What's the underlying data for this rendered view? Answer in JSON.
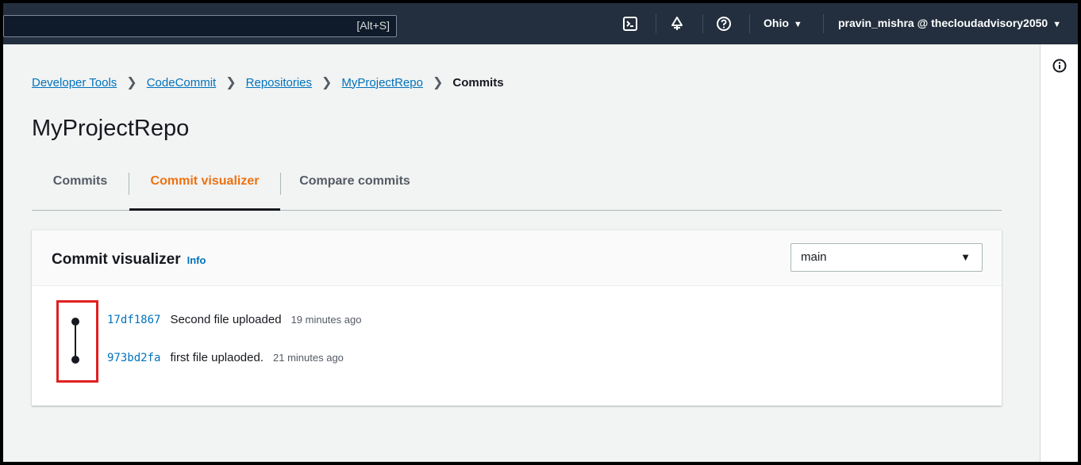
{
  "topbar": {
    "search_shortcut": "[Alt+S]",
    "region": "Ohio",
    "account": "pravin_mishra @ thecloudadvisory2050",
    "icons": [
      "cloudshell-icon",
      "bell-icon",
      "help-icon"
    ]
  },
  "breadcrumb": {
    "items": [
      "Developer Tools",
      "CodeCommit",
      "Repositories",
      "MyProjectRepo"
    ],
    "current": "Commits"
  },
  "page": {
    "title": "MyProjectRepo"
  },
  "tabs": [
    {
      "label": "Commits",
      "active": false
    },
    {
      "label": "Commit visualizer",
      "active": true
    },
    {
      "label": "Compare commits",
      "active": false
    }
  ],
  "visualizer": {
    "title": "Commit visualizer",
    "info_label": "Info",
    "branch": "main",
    "commits": [
      {
        "id": "17df1867",
        "message": "Second file uploaded",
        "time": "19 minutes ago"
      },
      {
        "id": "973bd2fa",
        "message": "first file uplaoded.",
        "time": "21 minutes ago"
      }
    ]
  },
  "colors": {
    "nav_bg": "#232f3e",
    "link": "#0073bb",
    "active_tab": "#ec7211",
    "highlight": "#e02020"
  }
}
